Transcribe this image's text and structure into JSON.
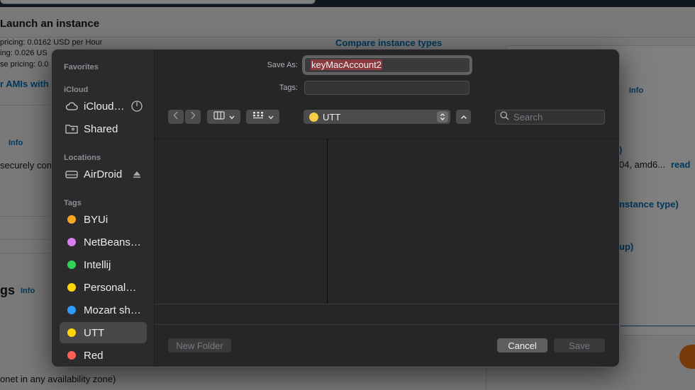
{
  "background_page": {
    "title": "Launch an instance",
    "pricing_lines": [
      "pricing: 0.0162 USD per Hour",
      "ing: 0.026 US",
      "se pricing: 0.0"
    ],
    "compare_link": "Compare instance types",
    "amis_link": "r AMIs with",
    "info_labels": [
      "Info",
      "Info",
      "Info"
    ],
    "securely_text": "securely con",
    "arch_text": "04, amd6...",
    "read_link": "read",
    "instance_type_text": "nstance type)",
    "group_text": "up)",
    "paren_text": ")",
    "settings_heading": "gs",
    "subnet_text": "onet in any availability zone)"
  },
  "dialog": {
    "save_as_label": "Save As:",
    "save_as_value": "keyMacAccount2",
    "tags_label": "Tags:",
    "location": "UTT",
    "search_placeholder": "Search",
    "new_folder": "New Folder",
    "cancel": "Cancel",
    "save": "Save",
    "sidebar": {
      "favorites_header": "Favorites",
      "icloud_header": "iCloud",
      "icloud_items": [
        {
          "label": "iCloud…",
          "icon": "cloud-icon"
        },
        {
          "label": "Shared",
          "icon": "shared-folder-icon"
        }
      ],
      "locations_header": "Locations",
      "locations_items": [
        {
          "label": "AirDroid",
          "icon": "drive-icon"
        }
      ],
      "tags_header": "Tags",
      "tags": [
        {
          "label": "BYUi",
          "color": "#f5a623"
        },
        {
          "label": "NetBeans…",
          "color": "#d77df0"
        },
        {
          "label": "Intellij",
          "color": "#30d158"
        },
        {
          "label": "Personal…",
          "color": "#ffd60a"
        },
        {
          "label": "Mozart sh…",
          "color": "#2f9bff"
        },
        {
          "label": "UTT",
          "color": "#ffd60a",
          "selected": true
        },
        {
          "label": "Red",
          "color": "#ff5f57"
        }
      ]
    }
  }
}
